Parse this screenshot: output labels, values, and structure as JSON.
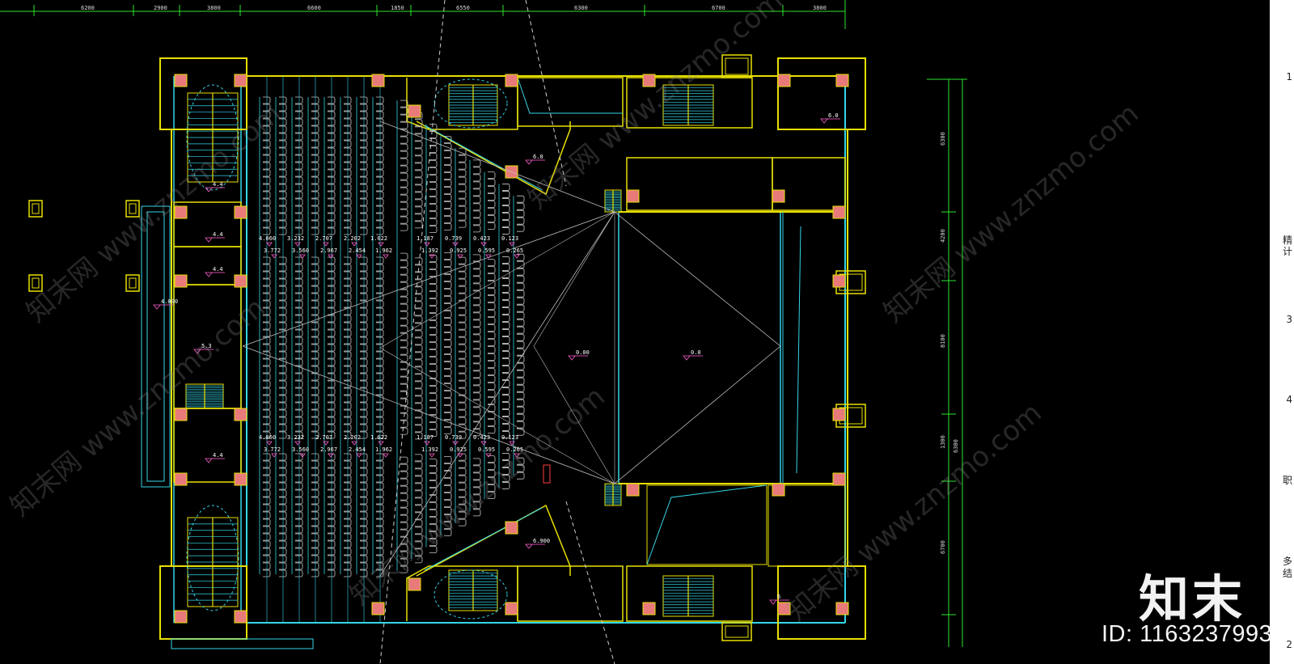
{
  "top_dimensions": [
    "6200",
    "2900",
    "3800",
    "6600",
    "1850",
    "6550",
    "6300",
    "6700",
    "3800"
  ],
  "right_dimensions": [
    "6300",
    "4200",
    "8100",
    "1300",
    "6700",
    "6300"
  ],
  "level_marks": {
    "stair_top_left": "4.4",
    "toilet_left_a": "4.4",
    "toilet_left_b": "4.4",
    "lobby_left": "5.3",
    "lower_left": "4.4",
    "corridor_left": "4.000",
    "upper_mid": "6.0",
    "top_right": "6.0",
    "stage_front": "0.00",
    "stage": "0.0",
    "lower_mid": "6.900",
    "lower_right": "6"
  },
  "seat_levels_upper_row1": [
    "4.060",
    "3.232",
    "2.707",
    "2.202",
    "1.622",
    "1.187",
    "0.739",
    "0.423",
    "0.123"
  ],
  "seat_levels_upper_row2": [
    "3.772",
    "3.560",
    "2.967",
    "2.454",
    "1.962",
    "1.392",
    "0.925",
    "0.595",
    "0.265"
  ],
  "seat_levels_lower_row1": [
    "4.060",
    "3.232",
    "2.707",
    "2.202",
    "1.622",
    "1.187",
    "0.739",
    "0.423",
    "0.123"
  ],
  "seat_levels_lower_row2": [
    "3.772",
    "3.560",
    "2.967",
    "2.454",
    "1.962",
    "1.392",
    "0.925",
    "0.595",
    "0.265"
  ],
  "watermark": {
    "logo": "知末",
    "id_text": "ID: 1163237993",
    "diagonal": "知末网 www.znzmo.com"
  },
  "right_strip_chars": [
    "1",
    "精",
    "计",
    "3",
    "4",
    "职",
    "多",
    "结",
    "2"
  ],
  "colors": {
    "background": "#000000",
    "wall_yellow": "#e8e000",
    "wall_cyan": "#34d6e8",
    "column_fill": "#e87a7a",
    "dim_green": "#2ee62e",
    "seat_gray": "#c8c8c8",
    "mark_magenta": "#ff5fd0"
  }
}
